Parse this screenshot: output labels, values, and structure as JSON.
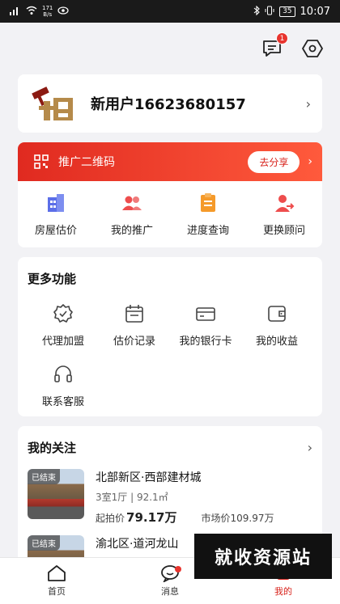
{
  "status": {
    "speed_value": "171",
    "speed_unit": "B/s",
    "battery": "35",
    "time": "10:07"
  },
  "header": {
    "message_badge": "1"
  },
  "user": {
    "name": "新用户16623680157"
  },
  "promo": {
    "label": "推广二维码",
    "share_label": "去分享"
  },
  "quick_actions": [
    {
      "label": "房屋估价",
      "icon": "building-icon",
      "color": "#5b6ee8"
    },
    {
      "label": "我的推广",
      "icon": "users-icon",
      "color": "#ee4d4d"
    },
    {
      "label": "进度查询",
      "icon": "clipboard-icon",
      "color": "#f59a2a"
    },
    {
      "label": "更换顾问",
      "icon": "user-swap-icon",
      "color": "#ee4d4d"
    }
  ],
  "more": {
    "title": "更多功能",
    "items": [
      {
        "label": "代理加盟",
        "icon": "badge-check-icon"
      },
      {
        "label": "估价记录",
        "icon": "calendar-icon"
      },
      {
        "label": "我的银行卡",
        "icon": "card-icon"
      },
      {
        "label": "我的收益",
        "icon": "wallet-icon"
      },
      {
        "label": "联系客服",
        "icon": "headset-icon"
      }
    ]
  },
  "follow": {
    "title": "我的关注",
    "items": [
      {
        "tag": "已结束",
        "title": "北部新区·西部建材城",
        "spec": "3室1厅 | 92.1㎡",
        "start_label": "起拍价",
        "start_price": "79.17万",
        "market": "市场价109.97万"
      },
      {
        "tag": "已结束",
        "title": "渝北区·道河龙山"
      }
    ]
  },
  "watermark": "就收资源站",
  "tabs": [
    {
      "label": "首页",
      "icon": "home-icon"
    },
    {
      "label": "消息",
      "icon": "chat-icon"
    },
    {
      "label": "我的",
      "icon": "profile-icon"
    }
  ],
  "colors": {
    "accent": "#d8231c",
    "background": "#f2f2f5"
  }
}
